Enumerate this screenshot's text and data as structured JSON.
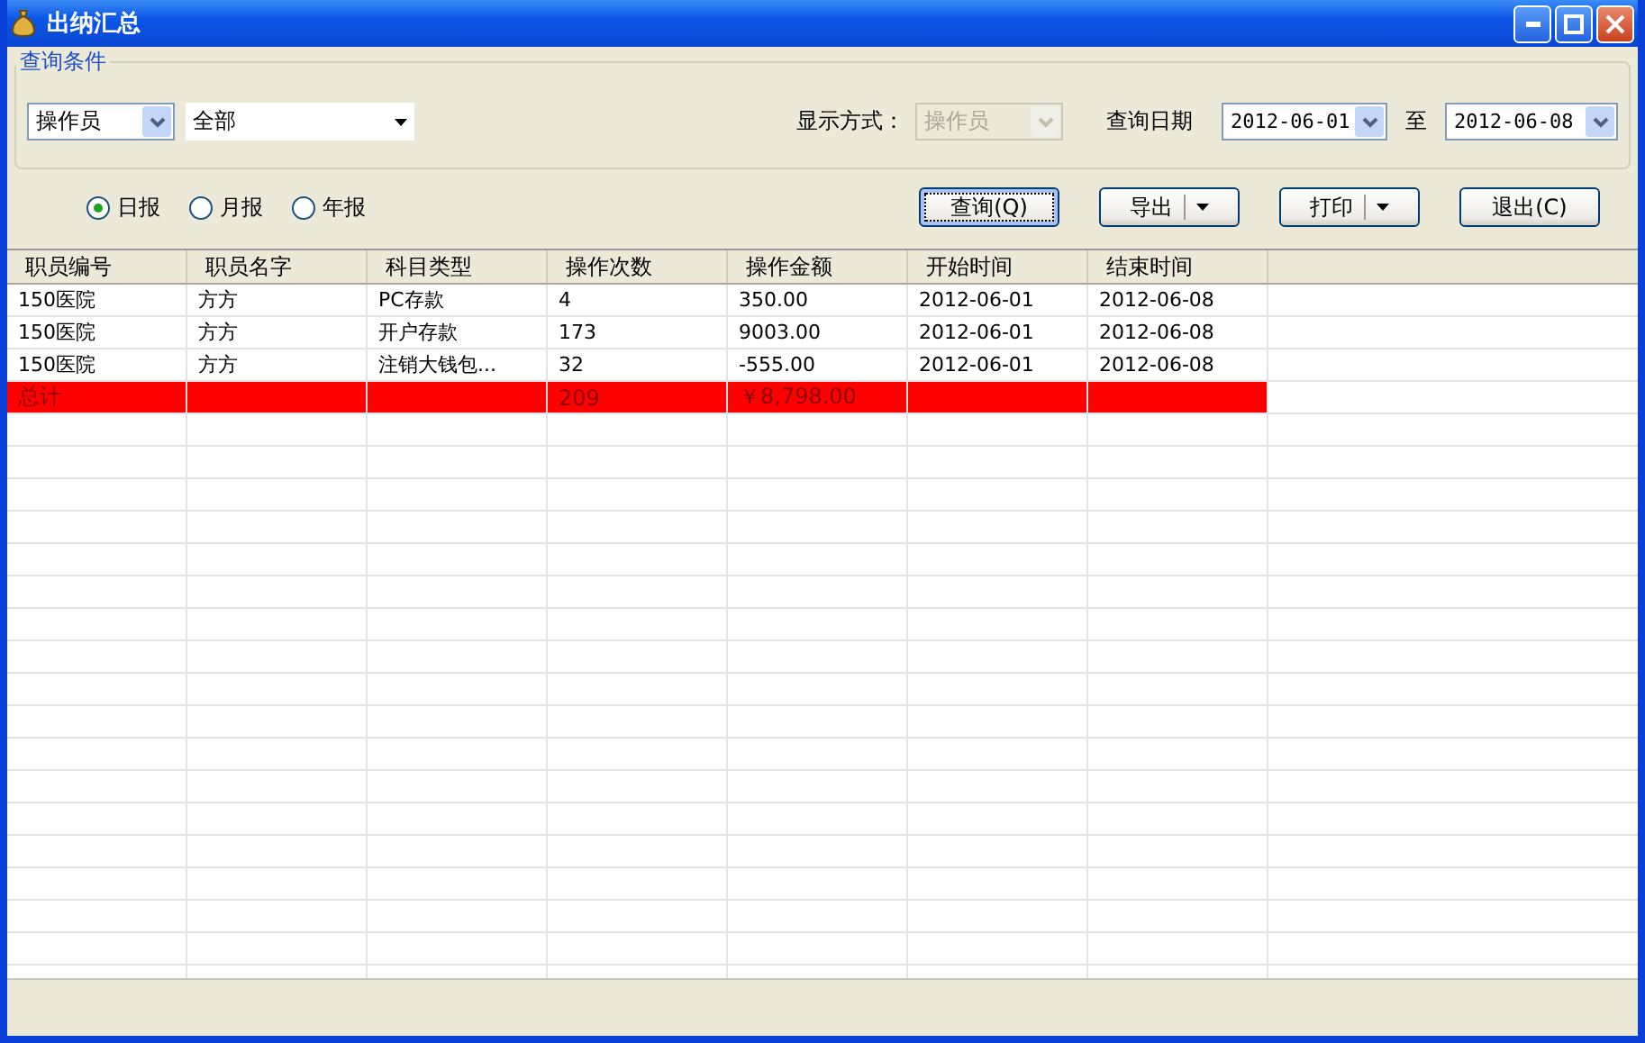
{
  "window": {
    "title": "出纳汇总"
  },
  "query_group": {
    "title": "查询条件"
  },
  "filter": {
    "field": "操作员",
    "value": "全部"
  },
  "display_mode": {
    "label": "显示方式：",
    "value": "操作员",
    "disabled": true
  },
  "date_range": {
    "label": "查询日期",
    "from": "2012-06-01",
    "separator": "至",
    "to": "2012-06-08"
  },
  "report_types": [
    {
      "label": "日报",
      "selected": true
    },
    {
      "label": "月报",
      "selected": false
    },
    {
      "label": "年报",
      "selected": false
    }
  ],
  "buttons": [
    {
      "label": "查询(Q)",
      "kind": "plain",
      "focused": true
    },
    {
      "label": "导出",
      "kind": "split",
      "focused": false
    },
    {
      "label": "打印",
      "kind": "split",
      "focused": false
    },
    {
      "label": "退出(C)",
      "kind": "plain",
      "focused": false
    }
  ],
  "table": {
    "columns": [
      "职员编号",
      "职员名字",
      "科目类型",
      "操作次数",
      "操作金额",
      "开始时间",
      "结束时间"
    ],
    "rows": [
      {
        "kind": "data",
        "cells": [
          "150医院",
          "方方",
          "PC存款",
          "4",
          "350.00",
          "2012-06-01",
          "2012-06-08"
        ]
      },
      {
        "kind": "data",
        "cells": [
          "150医院",
          "方方",
          "开户存款",
          "173",
          "9003.00",
          "2012-06-01",
          "2012-06-08"
        ]
      },
      {
        "kind": "data",
        "cells": [
          "150医院",
          "方方",
          "注销大钱包...",
          "32",
          "-555.00",
          "2012-06-01",
          "2012-06-08"
        ]
      },
      {
        "kind": "total",
        "cells": [
          "总计",
          "",
          "",
          "209",
          "￥8,798.00",
          "",
          ""
        ]
      }
    ]
  }
}
